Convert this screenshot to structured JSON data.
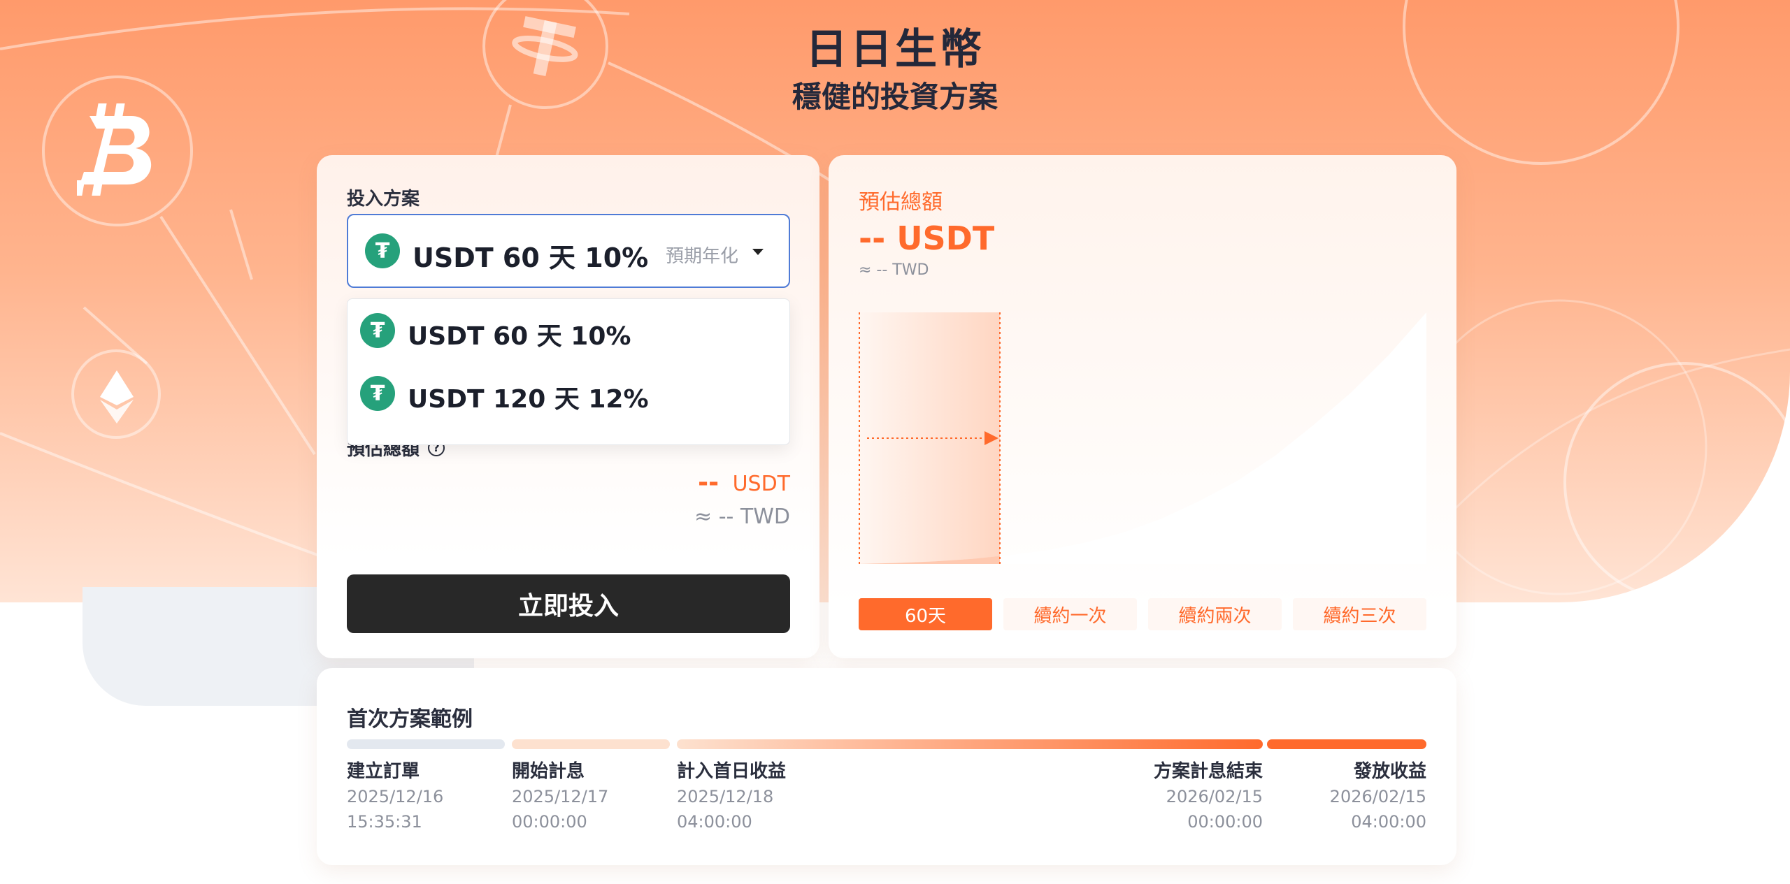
{
  "hero": {
    "title": "日日生幣",
    "subtitle": "穩健的投資方案"
  },
  "plan": {
    "label": "投入方案",
    "selected": {
      "icon": "tether-icon",
      "text": "USDT 60 天 10%",
      "hint": "預期年化"
    },
    "options": [
      {
        "icon": "tether-icon",
        "text": "USDT 60 天 10%"
      },
      {
        "icon": "tether-icon",
        "text": "USDT 120 天 12%"
      }
    ],
    "estimate_label": "預估總額",
    "amount_dash": "--",
    "amount_unit": "USDT",
    "twd": "≈ -- TWD",
    "invest_button": "立即投入"
  },
  "summary": {
    "label": "預估總額",
    "amount": "-- USDT",
    "twd": "≈ -- TWD",
    "tabs": [
      "60天",
      "續約一次",
      "續約兩次",
      "續約三次"
    ],
    "active_tab": 0
  },
  "chart_data": {
    "type": "area",
    "title": "",
    "xlabel": "",
    "ylabel": "",
    "highlight_period": "60天",
    "series": [
      {
        "values": [
          0.0,
          0.004,
          0.01,
          0.02,
          0.035,
          0.055,
          0.085,
          0.125,
          0.18,
          0.25,
          0.33,
          0.43,
          0.55,
          0.68,
          0.83,
          1.0
        ]
      }
    ]
  },
  "timeline": {
    "title": "首次方案範例",
    "colors": {
      "step1": "#e3e8ef",
      "step2": "#fde1cf",
      "accent": "#ff6a2c"
    },
    "steps": [
      {
        "name": "建立訂單",
        "date": "2025/12/16",
        "time": "15:35:31"
      },
      {
        "name": "開始計息",
        "date": "2025/12/17",
        "time": "00:00:00"
      },
      {
        "name": "計入首日收益",
        "date": "2025/12/18",
        "time": "04:00:00"
      },
      {
        "name": "方案計息結束",
        "date": "2026/02/15",
        "time": "00:00:00"
      },
      {
        "name": "發放收益",
        "date": "2026/02/15",
        "time": "04:00:00"
      }
    ]
  },
  "colors": {
    "accent": "#ff6a2c",
    "usdt": "#26a17b",
    "button": "#282828"
  }
}
